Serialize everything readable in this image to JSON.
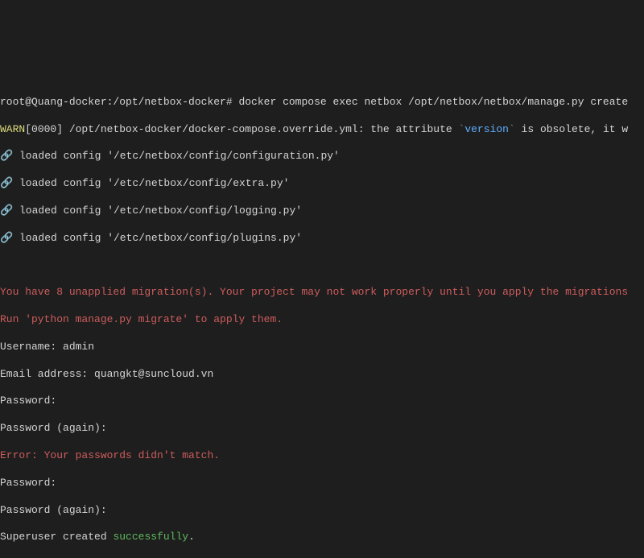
{
  "prompt": {
    "user_host_path": "root@Quang-docker:/opt/netbox-docker#",
    "command": " docker compose exec netbox /opt/netbox/netbox/manage.py create"
  },
  "warn": {
    "prefix": "WARN",
    "timestamp": "[0000]",
    "path": " /opt/netbox-docker/docker-compose.override.yml: the attribute ",
    "backtick1": "`",
    "attribute": "version",
    "backtick2": "`",
    "suffix": " is obsolete, it w"
  },
  "loaded": {
    "bullet": "🔗",
    "line1": " loaded config '/etc/netbox/config/configuration.py'",
    "line2": " loaded config '/etc/netbox/config/extra.py'",
    "line3": " loaded config '/etc/netbox/config/logging.py'",
    "line4": " loaded config '/etc/netbox/config/plugins.py'"
  },
  "migration": {
    "line1": "You have 8 unapplied migration(s). Your project may not work properly until you apply the migrations",
    "line2": "Run 'python manage.py migrate' to apply them."
  },
  "inputs": {
    "username_label": "Username: ",
    "username_value": "admin",
    "email_label": "Email address: ",
    "email_value": "quangkt@suncloud.vn",
    "password1": "Password: ",
    "password_again1": "Password (again): ",
    "error": "Error: Your passwords didn't match.",
    "password2": "Password: ",
    "password_again2": "Password (again): ",
    "success_prefix": "Superuser created ",
    "success_word": "successfully",
    "success_suffix": "."
  }
}
